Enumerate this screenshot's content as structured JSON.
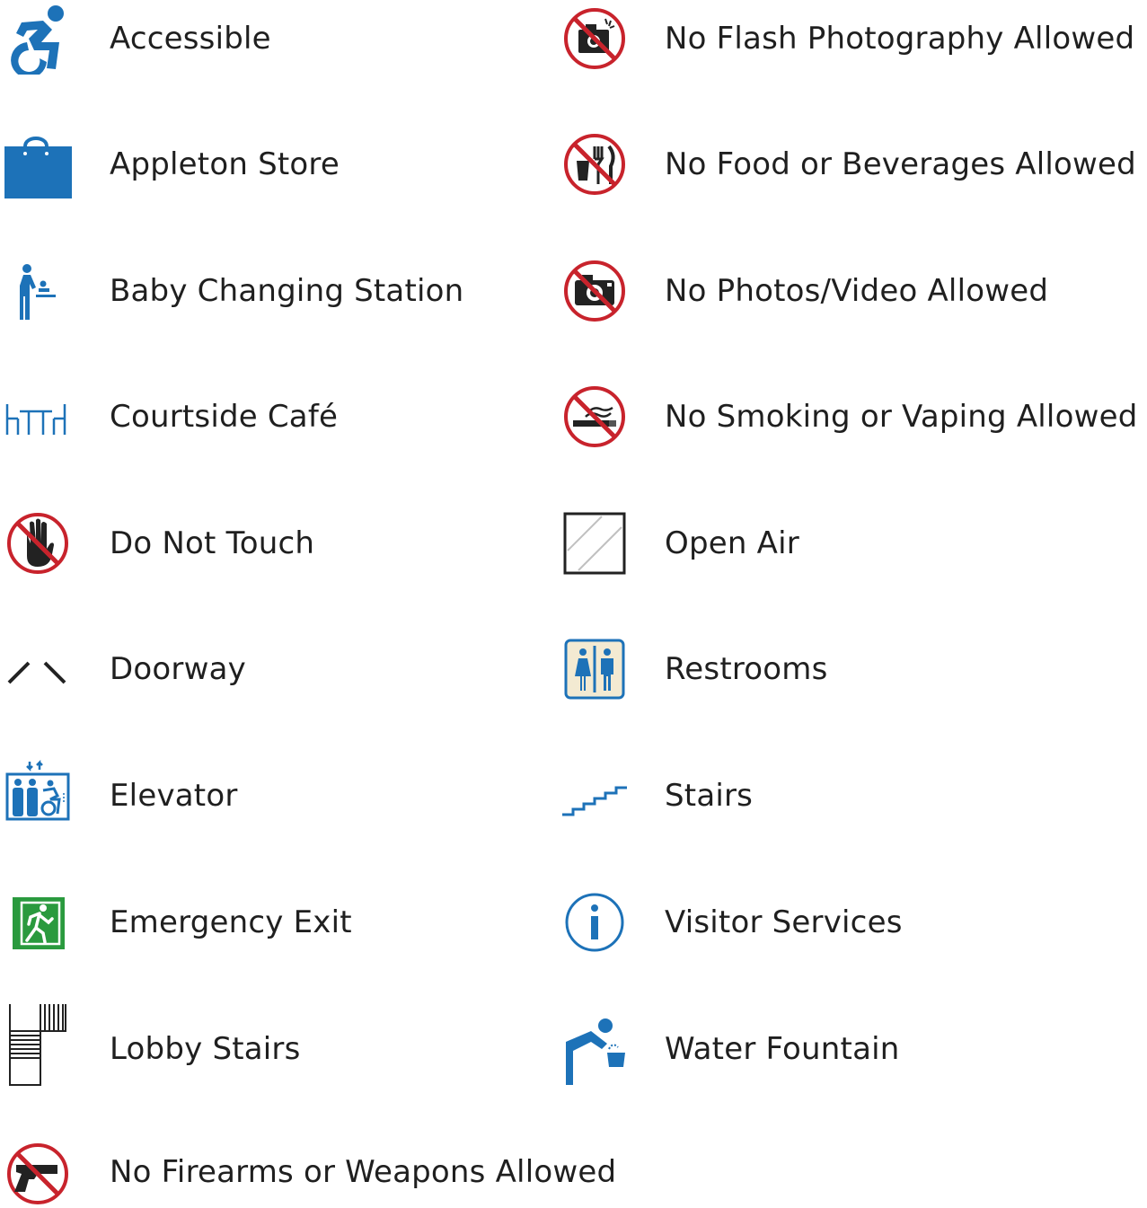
{
  "colors": {
    "blue": "#1d72b8",
    "red": "#c8232c",
    "green": "#2a9a3e",
    "dark": "#222222",
    "cream": "#f3ead2"
  },
  "legend": {
    "left": [
      {
        "label": "Accessible",
        "icon": "accessible-icon"
      },
      {
        "label": "Appleton Store",
        "icon": "shopping-bag-icon"
      },
      {
        "label": "Baby Changing Station",
        "icon": "baby-changing-icon"
      },
      {
        "label": "Courtside Café",
        "icon": "cafe-table-icon"
      },
      {
        "label": "Do Not Touch",
        "icon": "no-touch-icon"
      },
      {
        "label": "Doorway",
        "icon": "doorway-icon"
      },
      {
        "label": "Elevator",
        "icon": "elevator-icon"
      },
      {
        "label": "Emergency Exit",
        "icon": "emergency-exit-icon"
      },
      {
        "label": "Lobby Stairs",
        "icon": "lobby-stairs-icon"
      },
      {
        "label": "No Firearms or Weapons Allowed",
        "icon": "no-firearms-icon"
      }
    ],
    "right": [
      {
        "label": "No Flash Photography Allowed",
        "icon": "no-flash-icon"
      },
      {
        "label": "No Food or Beverages Allowed",
        "icon": "no-food-icon"
      },
      {
        "label": "No Photos/Video Allowed",
        "icon": "no-photos-icon"
      },
      {
        "label": "No Smoking or Vaping Allowed",
        "icon": "no-smoking-icon"
      },
      {
        "label": "Open Air",
        "icon": "open-air-icon"
      },
      {
        "label": "Restrooms",
        "icon": "restrooms-icon"
      },
      {
        "label": "Stairs",
        "icon": "stairs-icon"
      },
      {
        "label": "Visitor Services",
        "icon": "info-icon"
      },
      {
        "label": "Water Fountain",
        "icon": "water-fountain-icon"
      }
    ]
  }
}
